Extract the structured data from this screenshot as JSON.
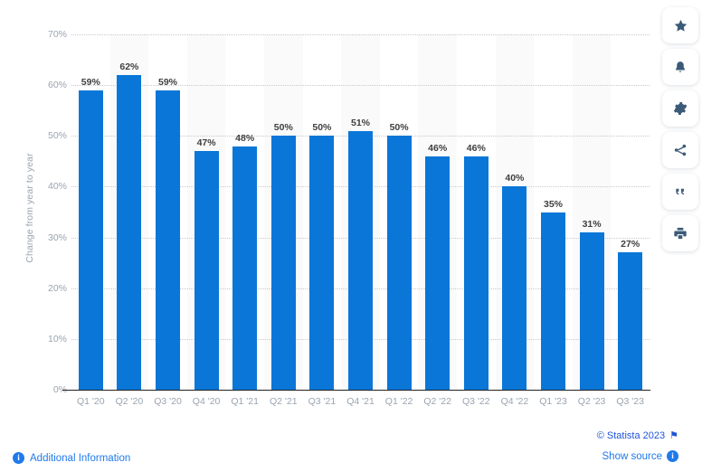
{
  "chart_data": {
    "type": "bar",
    "title": "",
    "xlabel": "",
    "ylabel": "Change from year to year",
    "ylim": [
      0,
      70
    ],
    "grid": true,
    "legend": "none",
    "yticks": [
      "0%",
      "10%",
      "20%",
      "30%",
      "40%",
      "50%",
      "60%",
      "70%"
    ],
    "ytick_values": [
      0,
      10,
      20,
      30,
      40,
      50,
      60,
      70
    ],
    "categories": [
      "Q1 '20",
      "Q2 '20",
      "Q3 '20",
      "Q4 '20",
      "Q1 '21",
      "Q2 '21",
      "Q3 '21",
      "Q4 '21",
      "Q1 '22",
      "Q2 '22",
      "Q3 '22",
      "Q4 '22",
      "Q1 '23",
      "Q2 '23",
      "Q3 '23"
    ],
    "values": [
      59,
      62,
      59,
      47,
      48,
      50,
      50,
      51,
      50,
      46,
      46,
      40,
      35,
      31,
      27
    ],
    "data_labels": [
      "59%",
      "62%",
      "59%",
      "47%",
      "48%",
      "50%",
      "50%",
      "51%",
      "50%",
      "46%",
      "46%",
      "40%",
      "35%",
      "31%",
      "27%"
    ],
    "bar_color": "#0a76d8",
    "band_color": "#fafafa",
    "label_color": "#3f3f3f",
    "axis_color": "#9aa4b0"
  },
  "sidebar": {
    "items": [
      {
        "name": "star-icon",
        "label": "Add to favorites"
      },
      {
        "name": "bell-icon",
        "label": "Notify me"
      },
      {
        "name": "gear-icon",
        "label": "Settings"
      },
      {
        "name": "share-icon",
        "label": "Share"
      },
      {
        "name": "quote-icon",
        "label": "Cite"
      },
      {
        "name": "print-icon",
        "label": "Print"
      }
    ]
  },
  "footer": {
    "additional_information": "Additional Information",
    "copyright": "© Statista 2023",
    "show_source": "Show source",
    "info_glyph": "i",
    "flag_glyph": "⚑"
  }
}
